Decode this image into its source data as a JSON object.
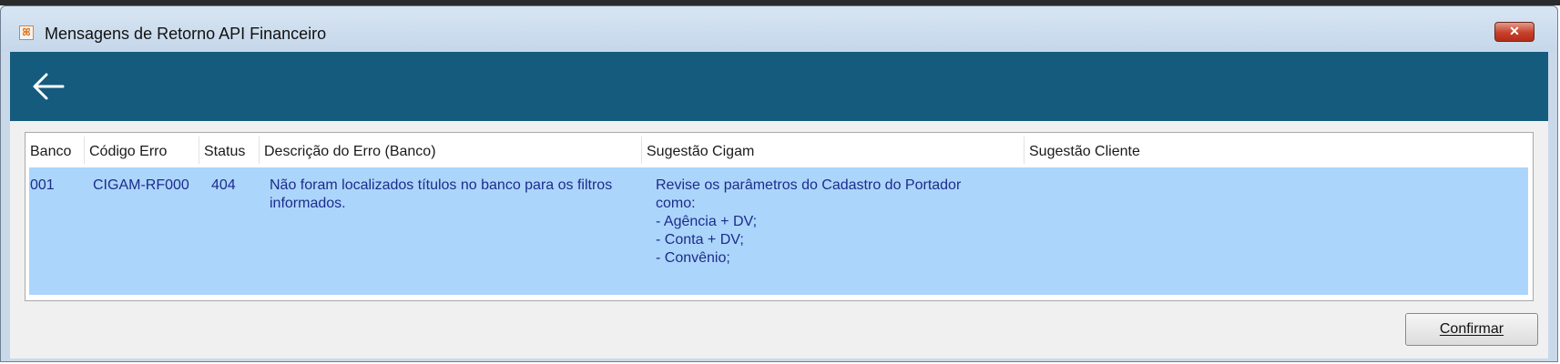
{
  "window": {
    "title": "Mensagens de Retorno API Financeiro",
    "icon": "app-icon",
    "close_symbol": "✕"
  },
  "header": {
    "back_icon": "arrow-left-icon",
    "color": "#145b7d"
  },
  "grid": {
    "columns": [
      "Banco",
      "Código Erro",
      "Status",
      "Descrição do Erro (Banco)",
      "Sugestão Cigam",
      "Sugestão Cliente"
    ],
    "rows": [
      {
        "banco": "001",
        "codigo_erro": "CIGAM-RF000",
        "status": "404",
        "descricao": [
          "Não foram localizados títulos no banco para os filtros",
          "informados."
        ],
        "sugestao_cigam": [
          "Revise os parâmetros do Cadastro do Portador",
          "como:",
          "- Agência + DV;",
          "- Conta + DV;",
          "- Convênio;"
        ],
        "sugestao_cliente": ""
      }
    ],
    "selected_row_color": "#acd5fb"
  },
  "footer": {
    "confirm_label": "Confirmar"
  }
}
